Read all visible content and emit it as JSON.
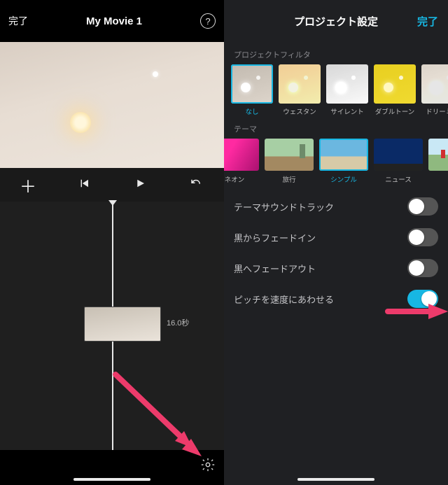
{
  "left": {
    "done": "完了",
    "title": "My Movie 1",
    "help": "?",
    "clip_duration": "16.0秒"
  },
  "right": {
    "title": "プロジェクト設定",
    "done": "完了",
    "section_filters": "プロジェクトフィルタ",
    "filters": [
      {
        "id": "none",
        "label": "なし",
        "selected": true
      },
      {
        "id": "western",
        "label": "ウェスタン",
        "selected": false
      },
      {
        "id": "silent",
        "label": "サイレント",
        "selected": false
      },
      {
        "id": "duo",
        "label": "ダブルトーン",
        "selected": false
      },
      {
        "id": "dreamy",
        "label": "ドリーミー",
        "selected": false
      }
    ],
    "section_themes": "テーマ",
    "themes": [
      {
        "id": "neon",
        "label": "ネオン",
        "selected": false
      },
      {
        "id": "travel",
        "label": "旅行",
        "selected": false
      },
      {
        "id": "simple",
        "label": "シンプル",
        "selected": true
      },
      {
        "id": "news",
        "label": "ニュース",
        "selected": false
      },
      {
        "id": "people",
        "label": "",
        "selected": false
      }
    ],
    "settings": [
      {
        "label": "テーマサウンドトラック",
        "on": false
      },
      {
        "label": "黒からフェードイン",
        "on": false
      },
      {
        "label": "黒へフェードアウト",
        "on": false
      },
      {
        "label": "ピッチを速度にあわせる",
        "on": true
      }
    ]
  },
  "accent": "#17b7e3",
  "annotation_color": "#ed3b6b"
}
